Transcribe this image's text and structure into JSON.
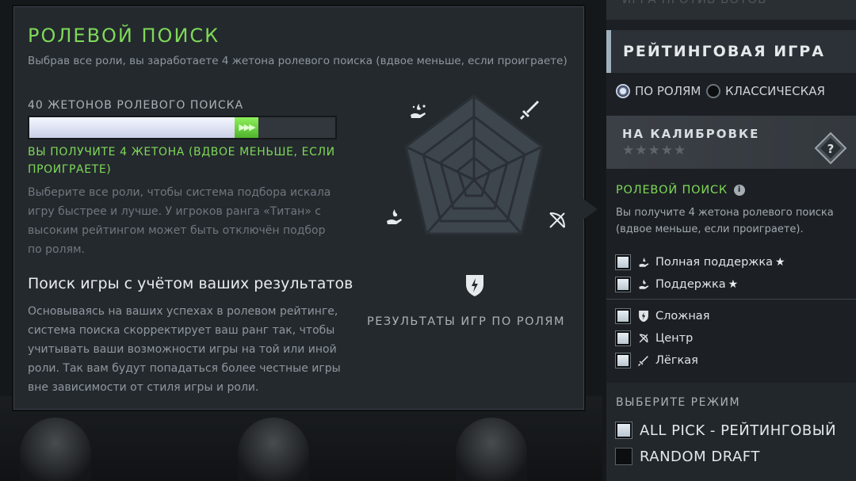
{
  "tooltip": {
    "title": "РОЛЕВОЙ ПОИСК",
    "subtitle": "Выбрав все роли, вы заработаете 4 жетона ролевого поиска (вдвое меньше, если проиграете)",
    "tokens_label": "40 ЖЕТОНОВ РОЛЕВОГО ПОИСКА",
    "token_bar_current_fraction": 0.67,
    "token_bar_gain_fraction": 0.08,
    "gain_text": "ВЫ ПОЛУЧИТЕ 4 ЖЕТОНА (ВДВОЕ МЕНЬШЕ, ЕСЛИ ПРОИГРАЕТЕ)",
    "description": "Выберите все роли, чтобы система подбора искала игру быстрее и лучше. У игроков ранга «Титан» с высоким рейтингом может быть отключён подбор по ролям.",
    "heading": "Поиск игры с учётом ваших результатов",
    "heading_text": "Основываясь на ваших успехах в ролевом рейтинге, система поиска скорректирует ваш ранг так, чтобы учитывать ваши возможности игры на той или иной роли. Так вам будут попадаться более честные игры вне зависимости от стиля игры и роли.",
    "radar_caption": "РЕЗУЛЬТАТЫ ИГР ПО РОЛЯМ",
    "radar_icons": [
      "hard-support-icon",
      "carry-sword-icon",
      "mid-bow-icon",
      "offlane-shield-icon",
      "support-hand-icon"
    ]
  },
  "right_panel": {
    "top_partial_label": "ИГРА ПРОТИВ БОТОВ",
    "ranked_title": "РЕЙТИНГОВАЯ ИГРА",
    "modes": [
      {
        "label": "ПО РОЛЯМ",
        "selected": true
      },
      {
        "label": "КЛАССИЧЕСКАЯ",
        "selected": false
      }
    ],
    "calibration_title": "НА КАЛИБРОВКЕ",
    "calibration_stars": "★★★★★",
    "role_search_title": "РОЛЕВОЙ ПОИСК",
    "role_search_sub": "Вы получите 4 жетона ролевого поиска (вдвое меньше, если проиграете).",
    "roles_support": [
      {
        "label": "Полная поддержка",
        "star": "★",
        "icon": "hard-support-icon"
      },
      {
        "label": "Поддержка",
        "star": "★",
        "icon": "support-hand-icon"
      }
    ],
    "roles_core": [
      {
        "label": "Сложная",
        "icon": "offlane-shield-icon"
      },
      {
        "label": "Центр",
        "icon": "mid-bow-icon"
      },
      {
        "label": "Лёгкая",
        "icon": "carry-sword-icon"
      }
    ],
    "pick_header": "ВЫБЕРИТЕ РЕЖИМ",
    "pick_modes": [
      {
        "label": "ALL PICK - РЕЙТИНГОВЫЙ",
        "checked": true
      },
      {
        "label": "RANDOM DRAFT",
        "checked": false
      }
    ]
  },
  "colors": {
    "accent_green": "#7ed957",
    "panel_bg": "#24292e",
    "page_bg": "#15181b"
  }
}
